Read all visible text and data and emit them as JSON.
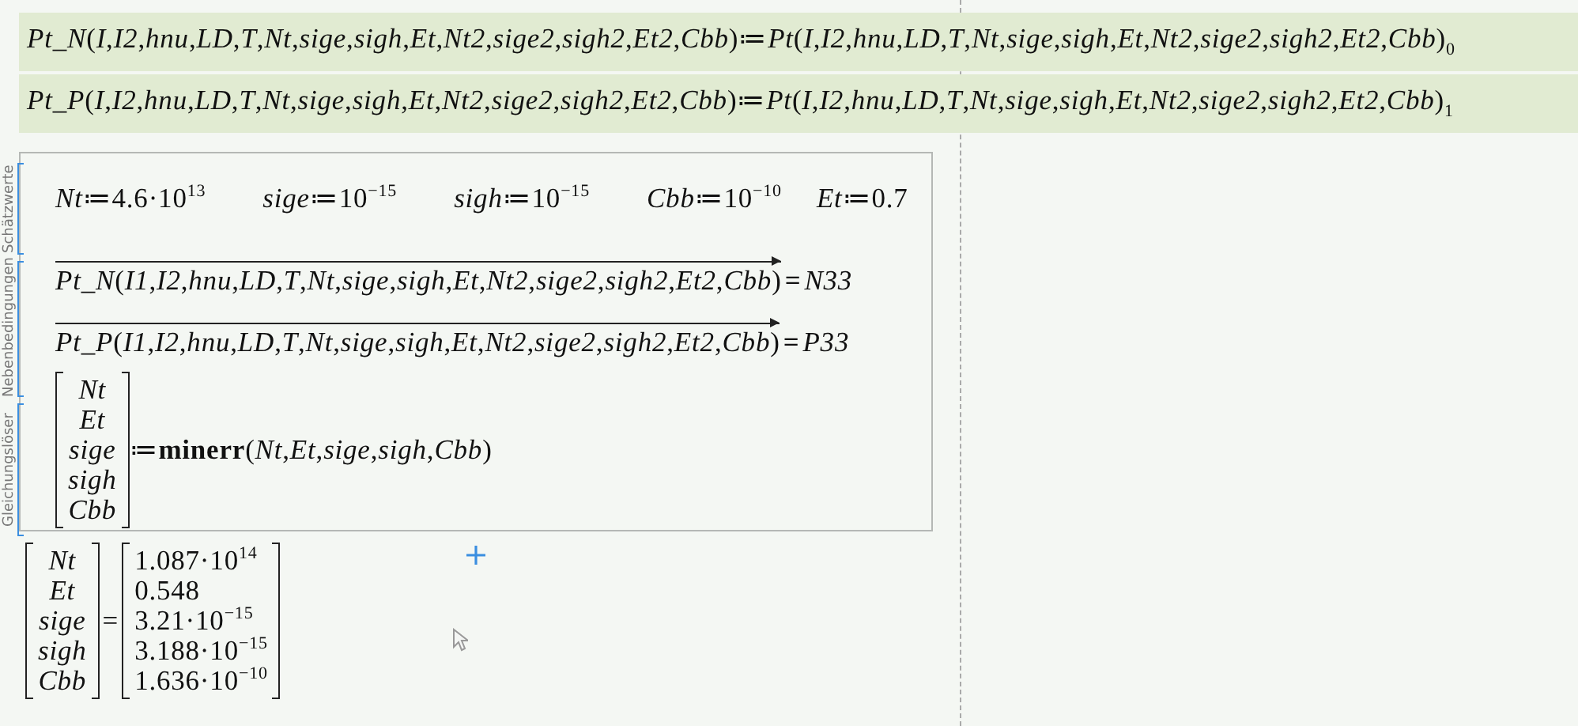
{
  "definitions": [
    {
      "expression": "*Pt_N*(*I*,*I2*,*hnu*,*LD*,*T*,*Nt*,*sige*,*sigh*,*Et*,*Nt2*,*sige2*,*sigh2*,*Et2*,*Cbb*)≔*Pt*(*I*,*I2*,*hnu*,*LD*,*T*,*Nt*,*sige*,*sigh*,*Et*,*Nt2*,*sige2*,*sigh2*,*Et2*,*Cbb*)$_{0}$"
    },
    {
      "expression": "*Pt_P*(*I*,*I2*,*hnu*,*LD*,*T*,*Nt*,*sige*,*sigh*,*Et*,*Nt2*,*sige2*,*sigh2*,*Et2*,*Cbb*)≔*Pt*(*I*,*I2*,*hnu*,*LD*,*T*,*Nt*,*sige*,*sigh*,*Et*,*Nt2*,*sige2*,*sigh2*,*Et2*,*Cbb*)$_{1}$"
    }
  ],
  "solve_block": {
    "labels": [
      "Schätzwerte",
      "Nebenbedingungen",
      "Gleichungslöser"
    ],
    "guesses": [
      "*Nt*≔4.6·10$^{13}$",
      "*sige*≔10$^{−15}$",
      "*sigh*≔10$^{−15}$",
      "*Cbb*≔10$^{−10}$",
      "*Et*≔0.7"
    ],
    "constraints": [
      {
        "expression": "*Pt_N*(*I1*,*I2*,*hnu*,*LD*,*T*,*Nt*,*sige*,*sigh*,*Et*,*Nt2*,*sige2*,*sigh2*,*Et2*,*Cbb*)",
        "operator": "=",
        "result": "N33"
      },
      {
        "expression": "*Pt_P*(*I1*,*I2*,*hnu*,*LD*,*T*,*Nt*,*sige*,*sigh*,*Et*,*Nt2*,*sige2*,*sigh2*,*Et2*,*Cbb*)",
        "operator": "=",
        "result": "P33"
      }
    ],
    "solver": {
      "vector": [
        "Nt",
        "Et",
        "sige",
        "sigh",
        "Cbb"
      ],
      "expression": "≔**minerr**(*Nt*,*Et*,*sige*,*sigh*,*Cbb*)"
    }
  },
  "result": {
    "vector": [
      "Nt",
      "Et",
      "sige",
      "sigh",
      "Cbb"
    ],
    "operator": "=",
    "values": [
      "1.087·10$^{14}$",
      "0.548",
      "3.21·10$^{−15}$",
      "3.188·10$^{−15}$",
      "1.636·10$^{−10}$"
    ]
  }
}
